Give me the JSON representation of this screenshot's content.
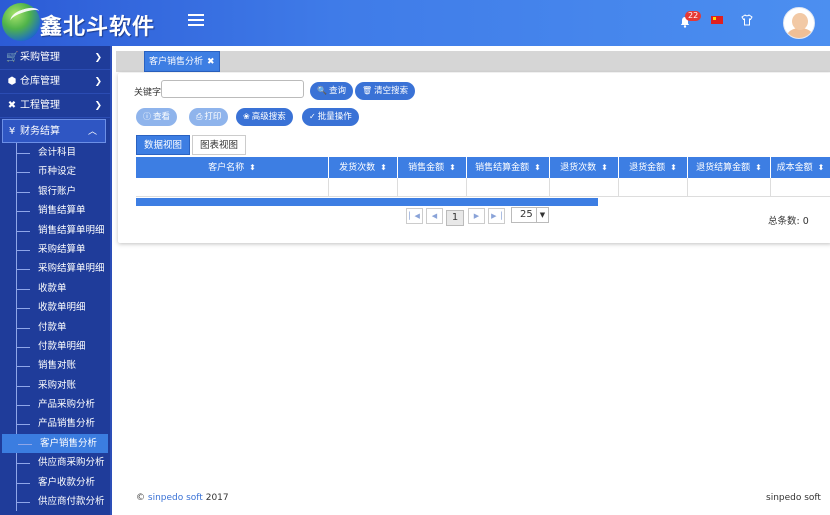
{
  "header": {
    "brand": "鑫北斗软件",
    "notification_count": "22"
  },
  "sidebar": {
    "groups": [
      {
        "label": "采购管理"
      },
      {
        "label": "仓库管理"
      },
      {
        "label": "工程管理"
      },
      {
        "label": "财务结算"
      }
    ],
    "finance_items": [
      "会计科目",
      "币种设定",
      "银行账户",
      "销售结算单",
      "销售结算单明细",
      "采购结算单",
      "采购结算单明细",
      "收款单",
      "收款单明细",
      "付款单",
      "付款单明细",
      "销售对账",
      "采购对账",
      "产品采购分析",
      "产品销售分析",
      "客户销售分析",
      "供应商采购分析",
      "客户收款分析",
      "供应商付款分析"
    ],
    "selected_item": "客户销售分析"
  },
  "tabs": {
    "active": "客户销售分析"
  },
  "search": {
    "keyword_label": "关键字",
    "keyword_value": "",
    "query_button": "查询",
    "clear_button": "清空搜索"
  },
  "toolbar": {
    "view": "查看",
    "print": "打印",
    "advanced_search": "高级搜索",
    "batch": "批量操作"
  },
  "view_tabs": {
    "data_view": "数据视图",
    "chart_view": "图表视图"
  },
  "grid": {
    "columns": [
      "客户名称",
      "发货次数",
      "销售金额",
      "销售结算金额",
      "退货次数",
      "退货金额",
      "退货结算金额",
      "成本金额"
    ]
  },
  "pager": {
    "page": "1",
    "page_size": "25",
    "total_label": "总条数: 0"
  },
  "footer": {
    "copyright": "©",
    "company_link": "sinpedo soft",
    "year": "2017",
    "right_text": "sinpedo soft"
  }
}
